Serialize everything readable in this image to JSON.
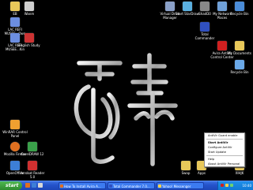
{
  "desktop_icons": [
    {
      "label": "EB",
      "icon": "folder-icon",
      "color": "#e8c85a"
    },
    {
      "label": "Wanm",
      "icon": "app-icon",
      "color": "#cfcfcf"
    },
    {
      "label": "LAC REFI MUSEE...Own",
      "icon": "document-icon",
      "color": "#6c8ee0"
    },
    {
      "label": "LAC REFI MUSEE...Kin",
      "icon": "document-icon",
      "color": "#6c8ee0"
    },
    {
      "label": "English Study",
      "icon": "book-icon",
      "color": "#cc3333"
    },
    {
      "label": "WinRAR Control Panel",
      "icon": "control-panel-icon",
      "color": "#f0a030"
    },
    {
      "label": "Mozilla Firefox",
      "icon": "firefox-icon",
      "color": "#e07020"
    },
    {
      "label": "CorelDRAW 12",
      "icon": "coreldraw-icon",
      "color": "#3aa04a"
    },
    {
      "label": "OpenOffice",
      "icon": "openoffice-icon",
      "color": "#3d7fd6"
    },
    {
      "label": "Acrobat Reader 5.0",
      "icon": "acrobat-icon",
      "color": "#d03030"
    },
    {
      "label": "Virtual Drive Manager",
      "icon": "drive-icon",
      "color": "#8aa0c8"
    },
    {
      "label": "Start StarDraw",
      "icon": "app-icon",
      "color": "#5ab0e0"
    },
    {
      "label": "ShadD0",
      "icon": "app-icon",
      "color": "#888888"
    },
    {
      "label": "My Network Places",
      "icon": "network-icon",
      "color": "#6fa0d8"
    },
    {
      "label": "Recycle Bin",
      "icon": "recycle-bin-icon",
      "color": "#4a8cd8"
    },
    {
      "label": "Total Commander",
      "icon": "total-commander-icon",
      "color": "#3050c0"
    },
    {
      "label": "Avira AntiVir Control Center",
      "icon": "antivir-icon",
      "color": "#d02020"
    },
    {
      "label": "My Documents",
      "icon": "folder-icon",
      "color": "#e8c85a"
    },
    {
      "label": "Recycle Bin",
      "icon": "recycle-bin-icon",
      "color": "#6aa8e8"
    },
    {
      "label": "Swap",
      "icon": "folder-icon",
      "color": "#e8c85a"
    },
    {
      "label": "Apps",
      "icon": "folder-icon",
      "color": "#e8c85a"
    },
    {
      "label": "XIHJK",
      "icon": "folder-icon",
      "color": "#e8c85a"
    }
  ],
  "context_menu": {
    "items": [
      {
        "label": "AntiVir Guard enable",
        "bold": false
      },
      {
        "label": "Start AntiVir",
        "bold": true
      },
      {
        "label": "Configure AntiVir",
        "bold": false
      },
      {
        "label": "Start Update",
        "bold": false
      },
      {
        "label": "Help",
        "bold": false
      },
      {
        "label": "About AntiVir Personal",
        "bold": false
      }
    ]
  },
  "taskbar": {
    "start_label": "start",
    "tasks": [
      {
        "label": "How To Install Avira A..."
      },
      {
        "label": "Total Commander 7.0..."
      },
      {
        "label": "Yahoo! Messenger"
      }
    ],
    "clock": "10:40"
  }
}
